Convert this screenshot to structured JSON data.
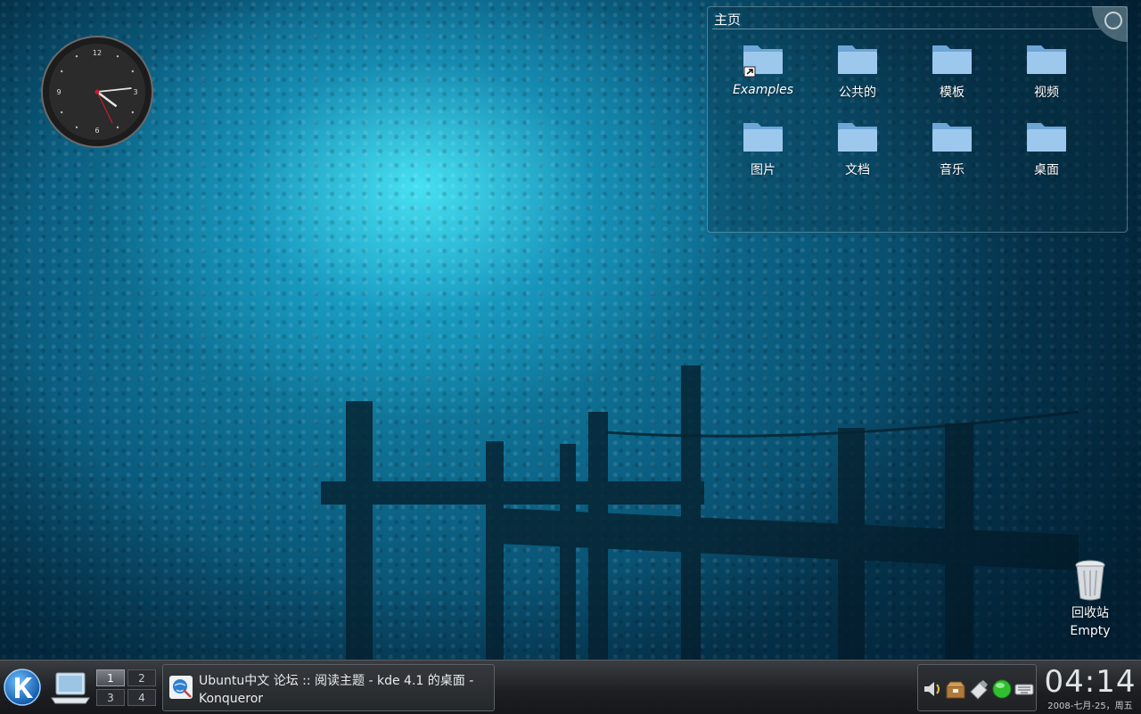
{
  "folderview": {
    "title": "主页",
    "items": [
      {
        "label": "Examples",
        "link": true
      },
      {
        "label": "公共的"
      },
      {
        "label": "模板"
      },
      {
        "label": "视频"
      },
      {
        "label": "图片"
      },
      {
        "label": "文档"
      },
      {
        "label": "音乐"
      },
      {
        "label": "桌面"
      }
    ]
  },
  "clock": {
    "numerals": [
      "12",
      "3",
      "6",
      "9"
    ],
    "hour": 4,
    "minute": 14
  },
  "trash": {
    "label": "回收站",
    "status": "Empty"
  },
  "panel": {
    "pager": [
      "1",
      "2",
      "3",
      "4"
    ],
    "active_desktop": "1",
    "task": {
      "title_line1": "Ubuntu中文 论坛 :: 阅读主题 - kde 4.1 的桌面 -",
      "title_line2": "Konqueror"
    },
    "tray_icons": [
      "volume-icon",
      "package-updates-icon",
      "usb-device-icon",
      "network-status-icon",
      "keyboard-icon"
    ],
    "clock": {
      "time": "04:14",
      "date": "2008-七月-25，周五"
    }
  },
  "colors": {
    "folder": "#8fc1ea",
    "panel": "#232529",
    "accent": "#1594b8"
  }
}
